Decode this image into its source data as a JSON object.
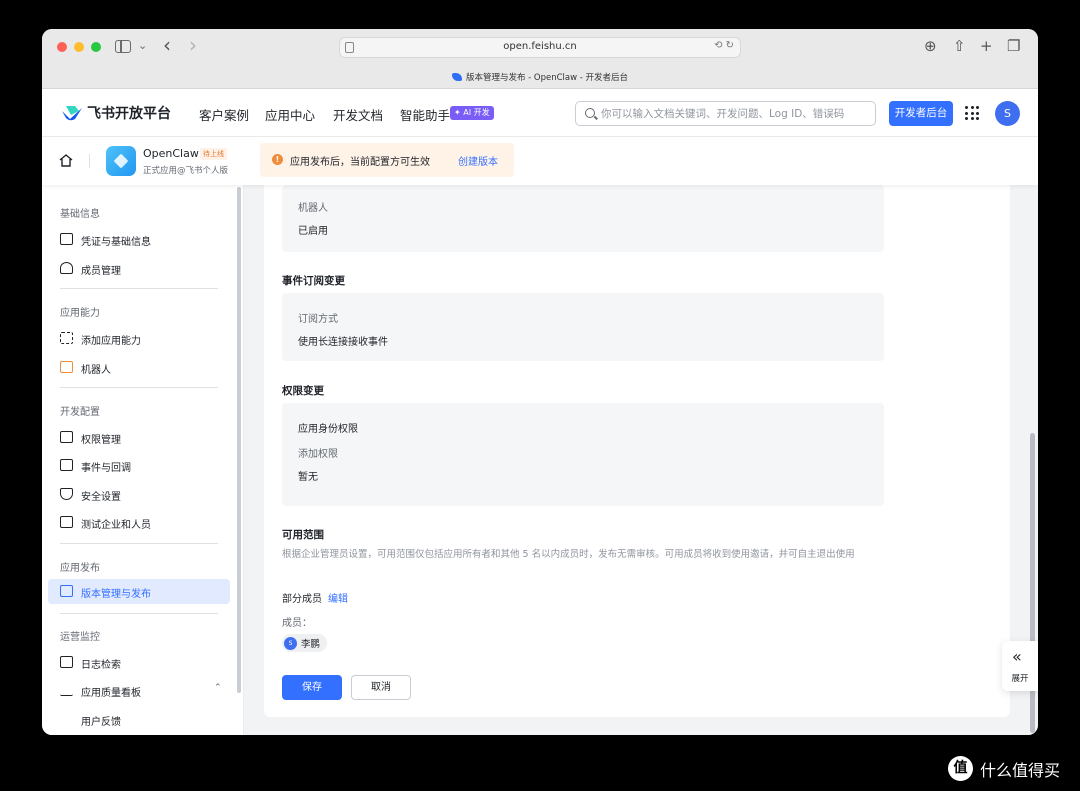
{
  "browser": {
    "url": "open.feishu.cn",
    "tab_title": "版本管理与发布 - OpenClaw - 开发者后台"
  },
  "header": {
    "brand": "飞书开放平台",
    "nav": [
      "客户案例",
      "应用中心",
      "开发文档",
      "智能助手"
    ],
    "ai_badge": "✦ AI 开发",
    "search_placeholder": "你可以输入文档关键词、开发问题、Log ID、错误码",
    "dev_console_button": "开发者后台",
    "avatar_letter": "S"
  },
  "app_bar": {
    "app_name": "OpenClaw",
    "status_badge": "待上线",
    "app_subtitle": "正式应用@飞书个人版",
    "notice_text": "应用发布后，当前配置方可生效",
    "notice_icon": "!",
    "notice_link": "创建版本"
  },
  "sidebar": {
    "groups": [
      {
        "title": "基础信息",
        "items": [
          "凭证与基础信息",
          "成员管理"
        ]
      },
      {
        "title": "应用能力",
        "items": [
          "添加应用能力",
          "机器人"
        ]
      },
      {
        "title": "开发配置",
        "items": [
          "权限管理",
          "事件与回调",
          "安全设置",
          "测试企业和人员"
        ]
      },
      {
        "title": "应用发布",
        "items": [
          "版本管理与发布"
        ]
      },
      {
        "title": "运营监控",
        "items": [
          "日志检索",
          "应用质量看板",
          "用户反馈"
        ]
      }
    ],
    "active_item": "版本管理与发布"
  },
  "content": {
    "bot_label": "机器人",
    "bot_value": "已启用",
    "event_section_title": "事件订阅变更",
    "event_method_label": "订阅方式",
    "event_method_value": "使用长连接接收事件",
    "perm_section_title": "权限变更",
    "perm_identity_title": "应用身份权限",
    "perm_added_label": "添加权限",
    "perm_added_value": "暂无",
    "scope_title": "可用范围",
    "scope_desc": "根据企业管理员设置，可用范围仅包括应用所有者和其他 5 名以内成员时，发布无需审核。可用成员将收到使用邀请，并可自主退出使用",
    "scope_partial_label": "部分成员",
    "scope_edit_link": "编辑",
    "members_label": "成员：",
    "member": {
      "avatar_letter": "S",
      "name": "李鹏"
    },
    "save_button": "保存",
    "cancel_button": "取消"
  },
  "expand_panel": {
    "icon": "«",
    "label": "展开"
  },
  "watermark": {
    "logo_glyph": "值",
    "text": "什么值得买"
  },
  "colors": {
    "primary": "#3370ff",
    "notice_bg": "#fff3e8",
    "notice_icon": "#f08c3a",
    "status_badge": "#e07a2f"
  }
}
